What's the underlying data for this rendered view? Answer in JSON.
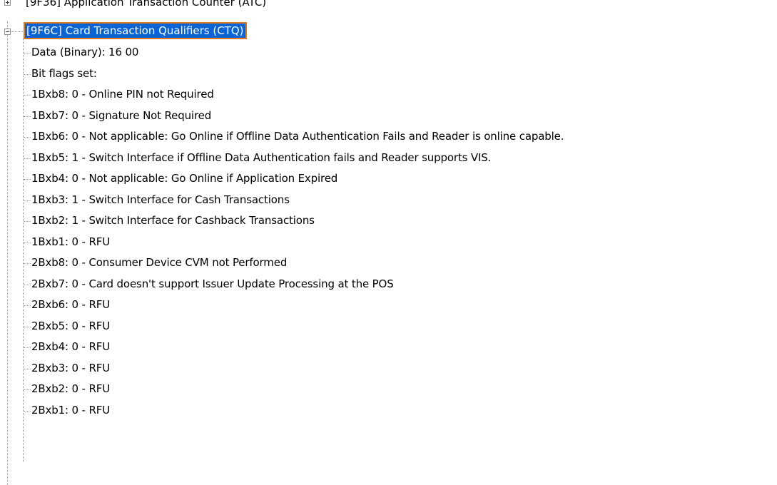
{
  "tree": {
    "previous_node_label": "[9F36] Application Transaction Counter (ATC)",
    "selected_node": {
      "label": "[9F6C] Card Transaction Qualifiers (CTQ)",
      "expanded": true,
      "children": [
        "Data (Binary): 16 00",
        "Bit flags set:",
        "1Bxb8: 0 - Online PIN not Required",
        "1Bxb7: 0 - Signature Not Required",
        "1Bxb6: 0 - Not applicable: Go Online if Offline Data Authentication Fails and Reader is online capable.",
        "1Bxb5: 1 - Switch Interface if Offline Data Authentication fails and Reader supports VIS.",
        "1Bxb4: 0 - Not applicable: Go Online if Application Expired",
        "1Bxb3: 1 - Switch Interface for Cash Transactions",
        "1Bxb2: 1 - Switch Interface for Cashback Transactions",
        "1Bxb1: 0 - RFU",
        "2Bxb8: 0 - Consumer Device CVM not Performed",
        "2Bxb7: 0 - Card doesn't support Issuer Update Processing at the POS",
        "2Bxb6: 0 - RFU",
        "2Bxb5: 0 - RFU",
        "2Bxb4: 0 - RFU",
        "2Bxb3: 0 - RFU",
        "2Bxb2: 0 - RFU",
        "2Bxb1: 0 - RFU"
      ]
    }
  },
  "colors": {
    "selection_background": "#0a64d6",
    "selection_focus_border": "#e27a1b",
    "tree_lines": "#a0a0a0"
  }
}
